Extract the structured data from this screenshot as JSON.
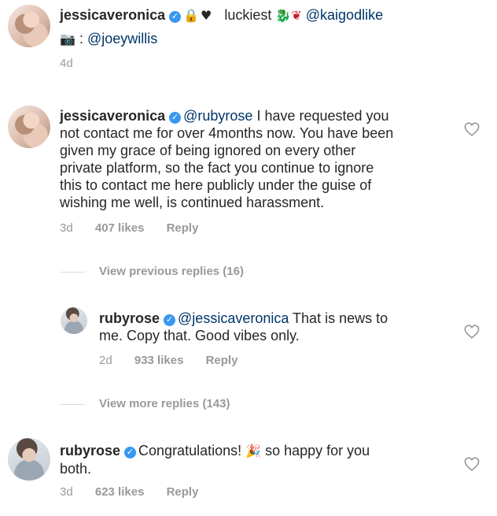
{
  "caption": {
    "username": "jessicaveronica",
    "text_part1": "luckiest",
    "mention": "@kaigodlike",
    "photo_credit_sep": ":",
    "photo_credit": "@joeywillis",
    "time": "4d"
  },
  "comment1": {
    "username": "jessicaveronica",
    "mention": "@rubyrose",
    "line1_rest": "I have requested you",
    "line2": "not contact me for over 4months now. You have been",
    "line3": "given my grace of being ignored on every other",
    "line4": "private platform, so the fact you continue to ignore",
    "line5": "this to contact me here publicly under the guise of",
    "line6": "wishing me well, is continued harassment.",
    "time": "3d",
    "likes": "407 likes",
    "reply": "Reply"
  },
  "view_previous": "View previous replies (16)",
  "reply1": {
    "username": "rubyrose",
    "mention": "@jessicaveronica",
    "line1_rest": "That is news to",
    "line2": "me. Copy that. Good vibes only.",
    "time": "2d",
    "likes": "933 likes",
    "reply": "Reply"
  },
  "view_more": "View more replies (143)",
  "comment2": {
    "username": "rubyrose",
    "text_part1": "Congratulations!",
    "text_part2": "so happy for you",
    "line2": "both.",
    "time": "3d",
    "likes": "623 likes",
    "reply": "Reply"
  },
  "colors": {
    "mention": "#003569",
    "verified": "#3897f0",
    "meta": "#999999"
  }
}
